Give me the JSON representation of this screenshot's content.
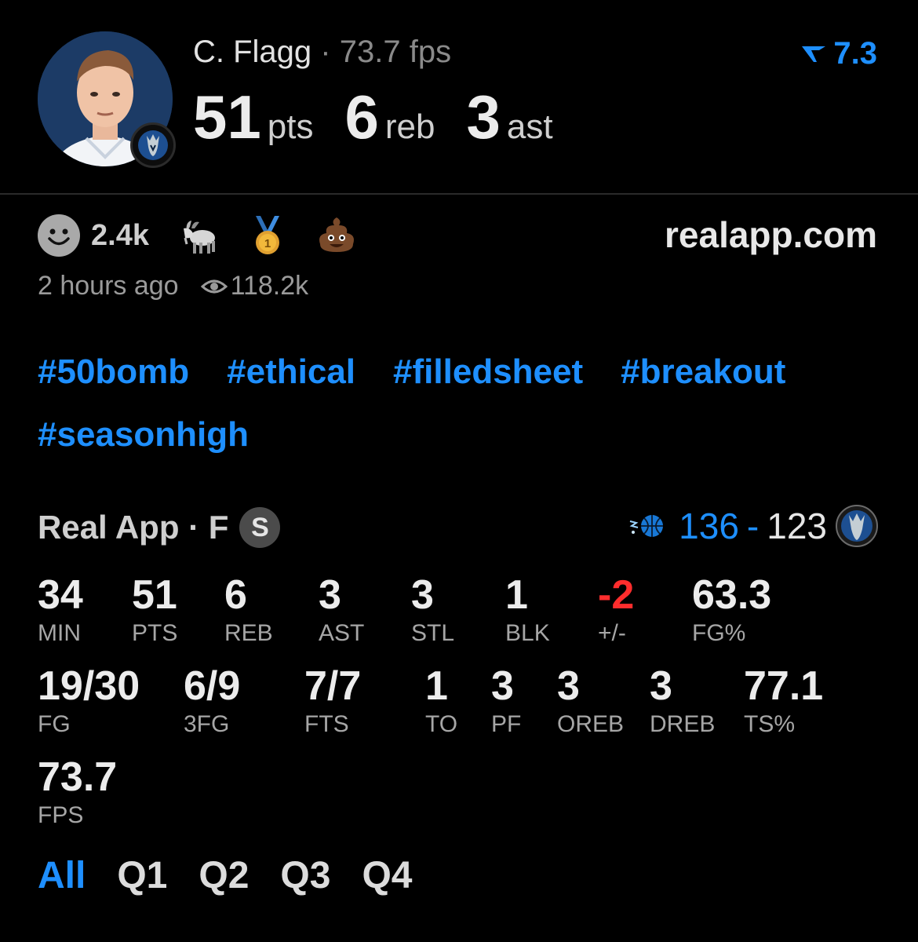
{
  "header": {
    "player_name": "C. Flagg",
    "separator": "·",
    "fps_text": "73.7 fps",
    "rating": "7.3",
    "headline": [
      {
        "value": "51",
        "label": "pts"
      },
      {
        "value": "6",
        "label": "reb"
      },
      {
        "value": "3",
        "label": "ast"
      }
    ]
  },
  "reactions": {
    "count": "2.4k",
    "icons": [
      "smiley-icon",
      "goat-icon",
      "medal-icon",
      "poop-icon"
    ],
    "site": "realapp.com",
    "time_ago": "2 hours ago",
    "views": "118.2k"
  },
  "hashtags": [
    "#50bomb",
    "#ethical",
    "#filledsheet",
    "#breakout",
    "#seasonhigh"
  ],
  "game": {
    "source": "Real App · F",
    "badge": "S",
    "score_win": "136",
    "score_sep": "-",
    "score_lose": "123"
  },
  "stats_row1": [
    {
      "value": "34",
      "label": "MIN"
    },
    {
      "value": "51",
      "label": "PTS"
    },
    {
      "value": "6",
      "label": "REB"
    },
    {
      "value": "3",
      "label": "AST"
    },
    {
      "value": "3",
      "label": "STL"
    },
    {
      "value": "1",
      "label": "BLK"
    },
    {
      "value": "-2",
      "label": "+/-"
    },
    {
      "value": "63.3",
      "label": "FG%"
    }
  ],
  "stats_row2": [
    {
      "value": "19/30",
      "label": "FG"
    },
    {
      "value": "6/9",
      "label": "3FG"
    },
    {
      "value": "7/7",
      "label": "FTS"
    },
    {
      "value": "1",
      "label": "TO"
    },
    {
      "value": "3",
      "label": "PF"
    },
    {
      "value": "3",
      "label": "OREB"
    },
    {
      "value": "3",
      "label": "DREB"
    },
    {
      "value": "77.1",
      "label": "TS%"
    }
  ],
  "stats_row3": [
    {
      "value": "73.7",
      "label": "FPS"
    }
  ],
  "periods": [
    "All",
    "Q1",
    "Q2",
    "Q3",
    "Q4"
  ],
  "colors": {
    "accent": "#1e8fff",
    "negative": "#ff2d2d"
  }
}
